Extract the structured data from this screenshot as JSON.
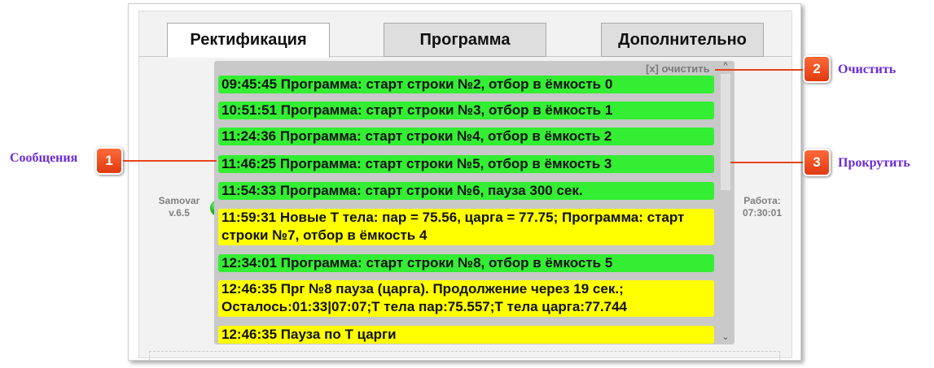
{
  "tabs": [
    {
      "label": "Ректификация",
      "active": true
    },
    {
      "label": "Программа",
      "active": false
    },
    {
      "label": "Дополнительно",
      "active": false
    }
  ],
  "device": {
    "name": "Samovar",
    "version": "v.6.5"
  },
  "runtime": {
    "label": "Работа:",
    "value": "07:30:01"
  },
  "log": {
    "clear_label": "[x] очистить",
    "messages": [
      {
        "text": "09:45:45 Программа: старт строки №2, отбор в ёмкость 0",
        "color": "#33ee33"
      },
      {
        "text": "10:51:51 Программа: старт строки №3, отбор в ёмкость 1",
        "color": "#33ee33"
      },
      {
        "text": "11:24:36 Программа: старт строки №4, отбор в ёмкость 2",
        "color": "#33ee33"
      },
      {
        "text": "11:46:25 Программа: старт строки №5, отбор в ёмкость 3",
        "color": "#33ee33"
      },
      {
        "text": "11:54:33 Программа: старт строки №6, пауза 300 сек.",
        "color": "#33ee33"
      },
      {
        "text": "11:59:31 Новые Т тела: пар = 75.56, царга = 77.75; Программа: старт строки №7, отбор в ёмкость 4",
        "color": "#ffff00"
      },
      {
        "text": "12:34:01 Программа: старт строки №8, отбор в ёмкость 5",
        "color": "#33ee33"
      },
      {
        "text": "12:46:35 Прг №8 пауза (царга). Продолжение через 19 сек.; Осталось:01:33|07:07;Т тела пар:75.557;Т тела царга:77.744",
        "color": "#ffff00"
      },
      {
        "text": "12:46:35 Пауза по Т царги",
        "color": "#ffff00"
      }
    ]
  },
  "callouts": [
    {
      "number": "1",
      "label": "Сообщения"
    },
    {
      "number": "2",
      "label": "Очистить"
    },
    {
      "number": "3",
      "label": "Прокрутить"
    }
  ],
  "icons": {
    "scroll_up": "chevron-up-icon",
    "scroll_down": "chevron-down-icon",
    "status": "status-led-icon"
  },
  "colors": {
    "message_green": "#33ee33",
    "message_yellow": "#ffff00",
    "callout": "#e8441a",
    "callout_label": "#6a2bd9"
  }
}
